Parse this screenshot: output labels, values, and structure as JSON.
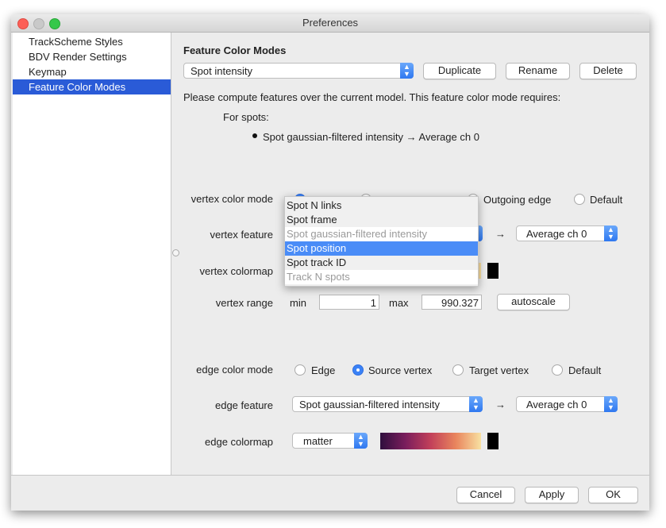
{
  "window": {
    "title": "Preferences"
  },
  "sidebar": {
    "items": [
      {
        "label": "TrackScheme Styles"
      },
      {
        "label": "BDV Render Settings"
      },
      {
        "label": "Keymap"
      },
      {
        "label": "Feature Color Modes",
        "selected": true
      }
    ]
  },
  "main": {
    "heading": "Feature Color Modes",
    "mode_select": "Spot intensity",
    "duplicate": "Duplicate",
    "rename": "Rename",
    "delete": "Delete",
    "notice": "Please compute features over the current model. This feature color mode requires:",
    "for_spots": "For spots:",
    "requirement": "Spot gaussian-filtered intensity → Average ch 0",
    "vertex": {
      "color_mode_label": "vertex color mode",
      "radio_outgoing": "Outgoing edge",
      "radio_default": "Default",
      "selected_radio_index": 0,
      "feature_label": "vertex feature",
      "projection": "Average ch 0",
      "arrow": "→",
      "colormap_label": "vertex colormap",
      "range_label": "vertex range",
      "min_label": "min",
      "min": "1",
      "max_label": "max",
      "max": "990.327",
      "autoscale": "autoscale"
    },
    "edge": {
      "color_mode_label": "edge color mode",
      "radios": [
        "Edge",
        "Source vertex",
        "Target vertex",
        "Default"
      ],
      "selected": "Source vertex",
      "feature_label": "edge feature",
      "feature": "Spot gaussian-filtered intensity",
      "arrow": "→",
      "projection": "Average ch 0",
      "colormap_label": "edge colormap",
      "colormap": "matter"
    }
  },
  "popup": {
    "items": [
      {
        "label": "Spot N links"
      },
      {
        "label": "Spot frame"
      },
      {
        "label": "Spot gaussian-filtered intensity",
        "disabled": true
      },
      {
        "label": "Spot position",
        "highlighted": true
      },
      {
        "label": "Spot track ID"
      },
      {
        "label": "Track N spots",
        "disabled": true
      }
    ]
  },
  "footer": {
    "cancel": "Cancel",
    "apply": "Apply",
    "ok": "OK"
  },
  "colors": {
    "accent": "#2a5bd7",
    "highlight": "#4a8cf7",
    "colormap_matter": [
      "#2f0f3e",
      "#7a1d5c",
      "#c2405a",
      "#e9855d",
      "#f8e1a2"
    ]
  }
}
